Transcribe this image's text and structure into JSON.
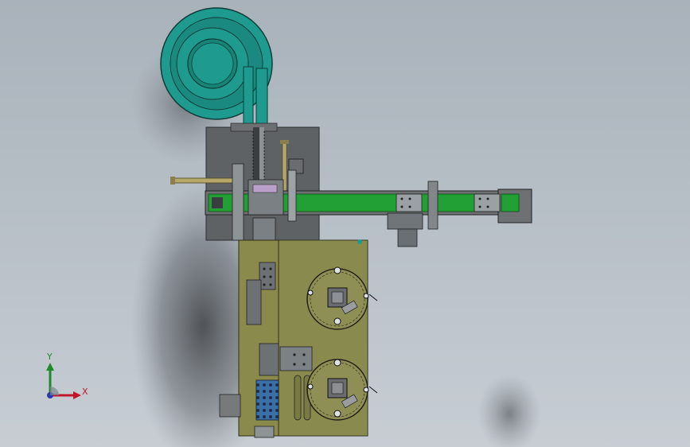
{
  "axis": {
    "y_label": "Y",
    "x_label": "X"
  },
  "colors": {
    "background_top": "#a9b1ba",
    "background_bottom": "#c7cdd3",
    "bowl": "#1e9a8f",
    "base_plate": "#8a8a4c",
    "frame": "#5f6265",
    "conveyor": "#22a035"
  },
  "icons": {
    "triad": "coordinate-triad-icon"
  }
}
